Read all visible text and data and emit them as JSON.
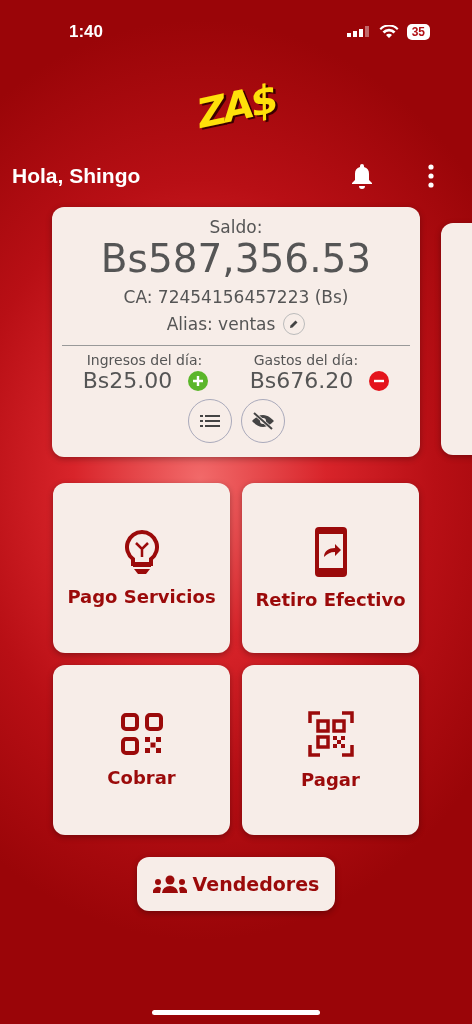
{
  "status_bar": {
    "time": "1:40",
    "battery": "35"
  },
  "logo": "ZA$",
  "greeting": "Hola, Shingo",
  "account_card": {
    "balance_label": "Saldo:",
    "balance": "Bs587,356.53",
    "account": "CA: 72454156457223 (Bs)",
    "alias": "Alias: ventas",
    "stats": [
      {
        "kind": "income",
        "label": "Ingresos del día:",
        "amount": "Bs25.00"
      },
      {
        "kind": "expense",
        "label": "Gastos del día:",
        "amount": "Bs676.20"
      }
    ]
  },
  "actions": [
    {
      "kind": "bulb",
      "label": "Pago Servicios"
    },
    {
      "kind": "phone",
      "label": "Retiro Efectivo"
    },
    {
      "kind": "qr",
      "label": "Cobrar"
    },
    {
      "kind": "scan",
      "label": "Pagar"
    }
  ],
  "sellers_button": "Vendedores"
}
